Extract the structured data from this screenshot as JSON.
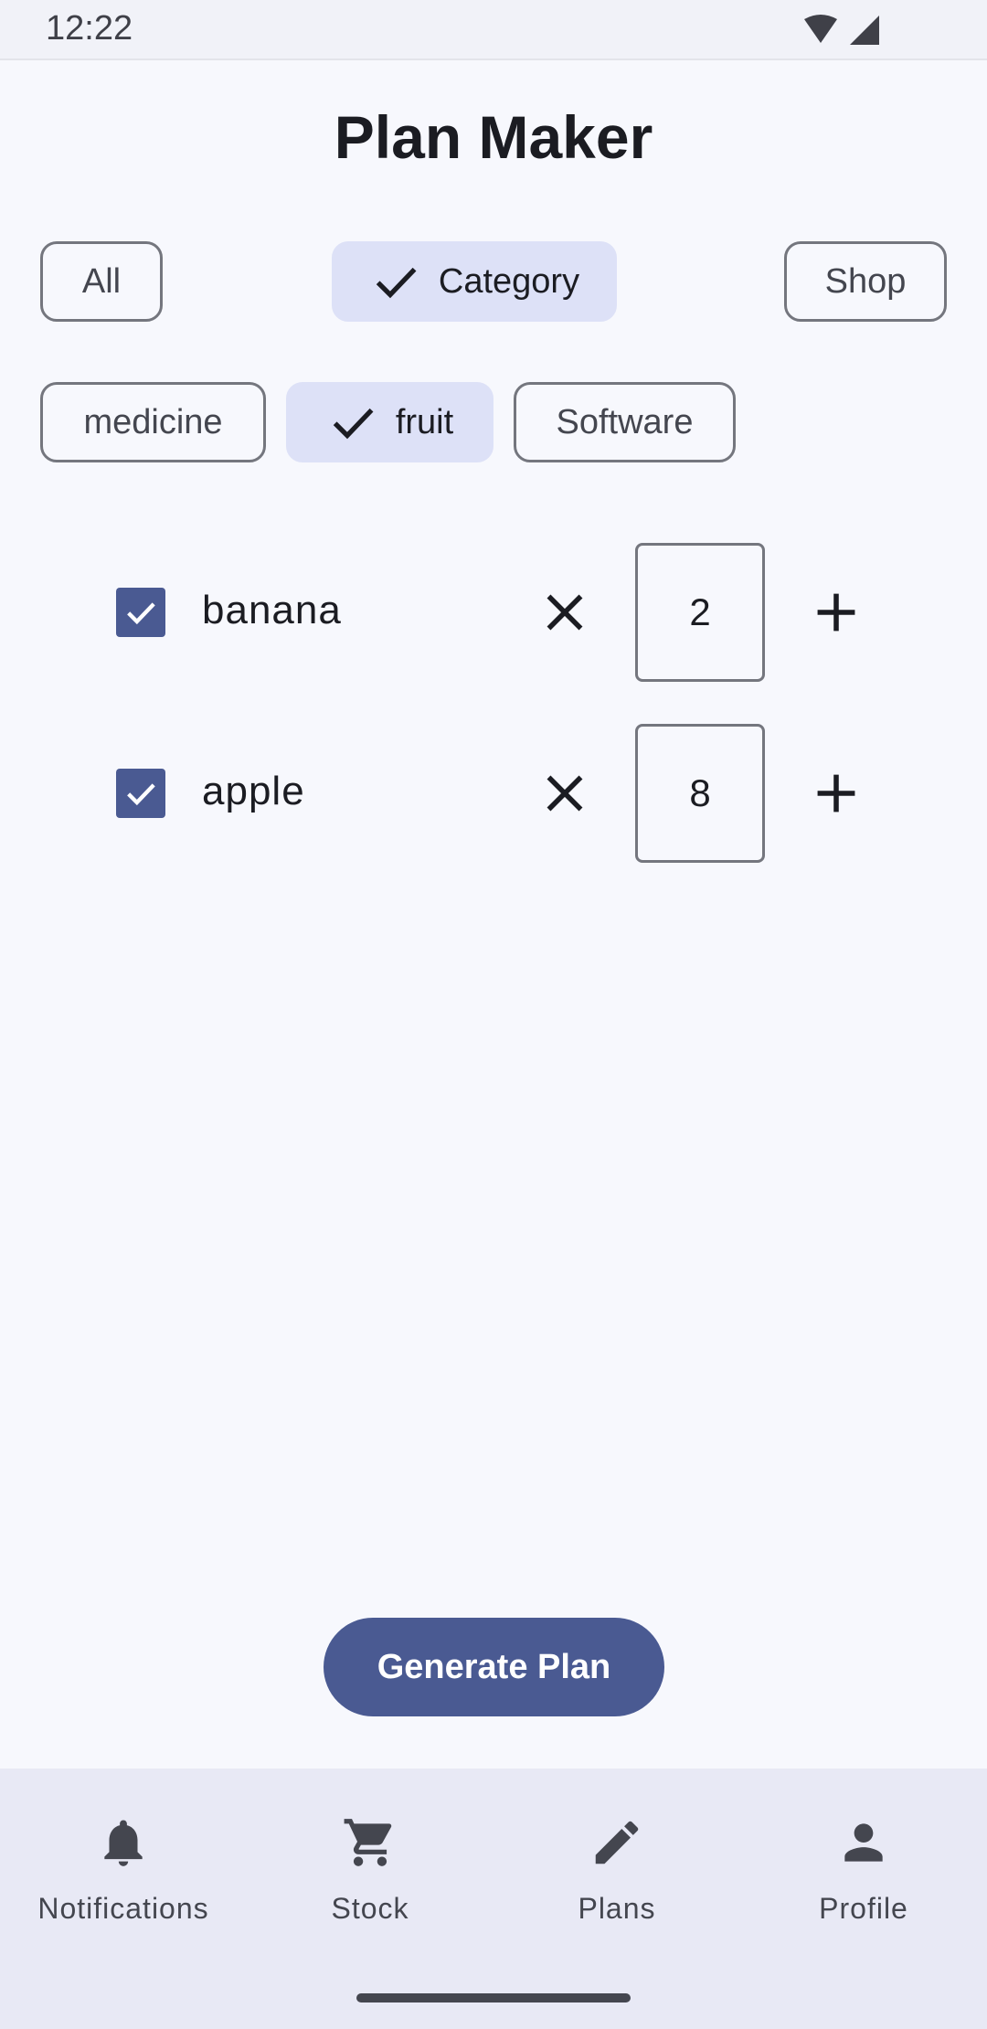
{
  "status_bar": {
    "time": "12:22",
    "wifi_icon": "wifi-icon",
    "signal_icon": "signal-icon"
  },
  "title": "Plan Maker",
  "filter_chips": [
    {
      "label": "All",
      "selected": false
    },
    {
      "label": "Category",
      "selected": true
    },
    {
      "label": "Shop",
      "selected": false
    }
  ],
  "category_chips": [
    {
      "label": "medicine",
      "selected": false
    },
    {
      "label": "fruit",
      "selected": true
    },
    {
      "label": "Software",
      "selected": false
    }
  ],
  "items": [
    {
      "name": "banana",
      "checked": true,
      "quantity": "2"
    },
    {
      "name": "apple",
      "checked": true,
      "quantity": "8"
    }
  ],
  "generate_button": "Generate Plan",
  "bottom_nav": [
    {
      "label": "Notifications",
      "icon": "bell-icon"
    },
    {
      "label": "Stock",
      "icon": "cart-icon"
    },
    {
      "label": "Plans",
      "icon": "pencil-icon"
    },
    {
      "label": "Profile",
      "icon": "person-icon"
    }
  ],
  "colors": {
    "primary": "#4a5a92",
    "chip_selected": "#dde1f7",
    "background": "#f7f8fd",
    "nav_background": "#e8e9f5"
  }
}
